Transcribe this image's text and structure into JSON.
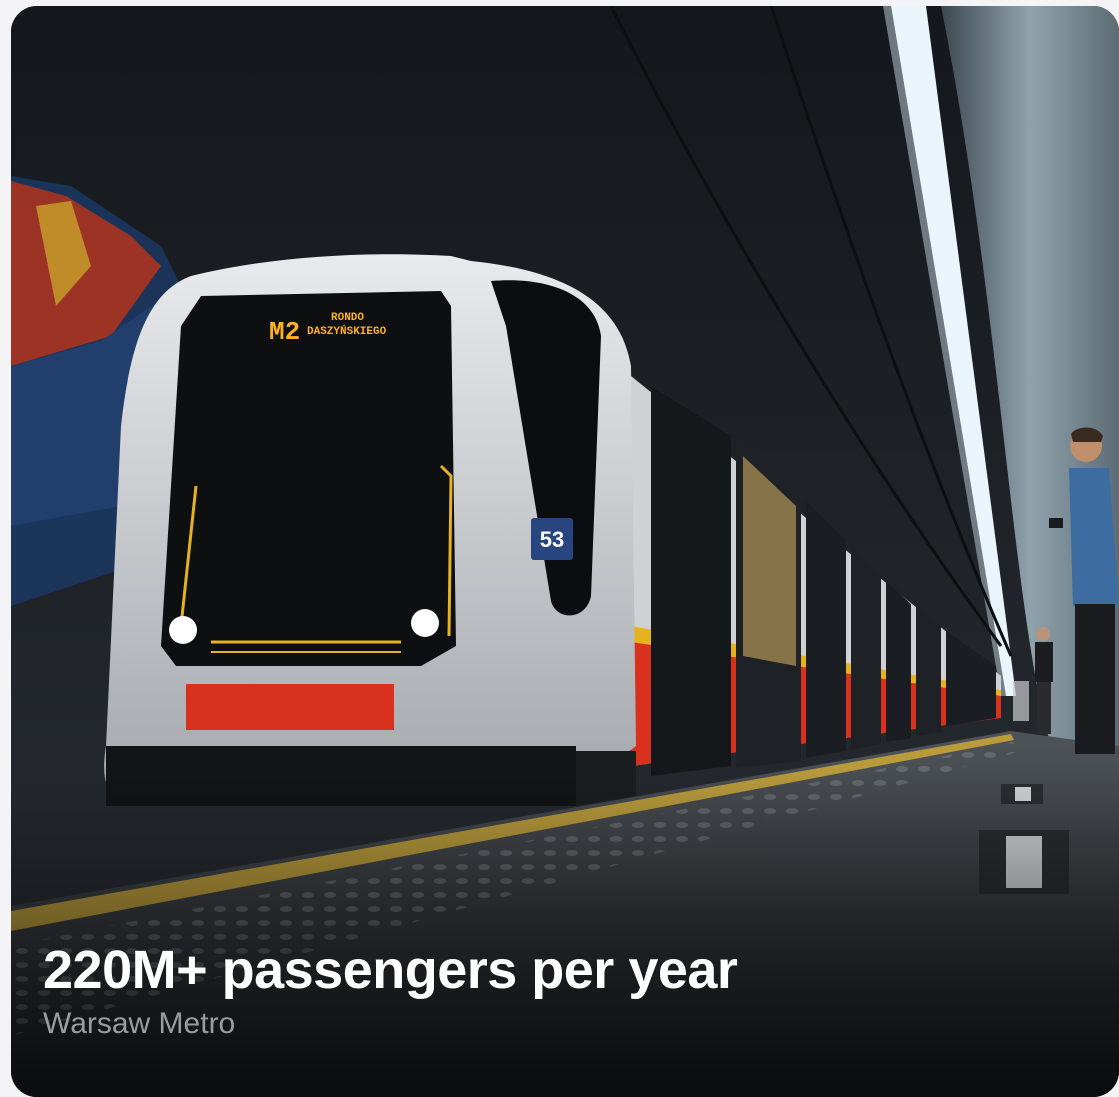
{
  "card": {
    "headline": "220M+ passengers per year",
    "subline": "Warsaw Metro"
  },
  "photo": {
    "destination_sign": {
      "line": "M2",
      "station_line1": "RONDO",
      "station_line2": "DASZYŃSKIEGO"
    },
    "car_number": "53"
  },
  "colors": {
    "headline": "#ffffff",
    "subline": "#9a9ca2",
    "train_red": "#d8321f",
    "train_yellow": "#e6b21e",
    "sign_amber": "#ffb21e"
  }
}
